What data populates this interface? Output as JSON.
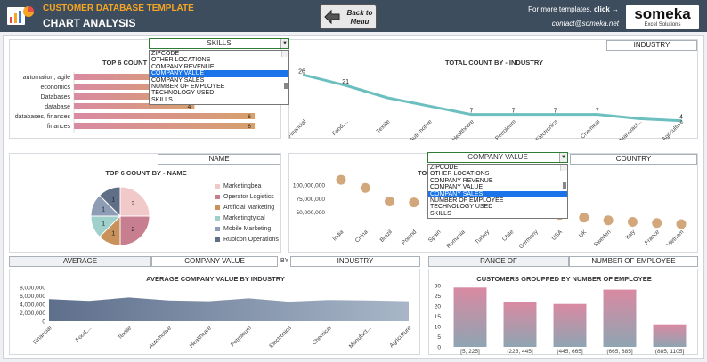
{
  "header": {
    "app_title": "CUSTOMER DATABASE TEMPLATE",
    "page_title": "CHART ANALYSIS",
    "back_button": {
      "line1": "Back to",
      "line2": "Menu"
    },
    "more_templates_prefix": "For more templates, ",
    "more_templates_link": "click →",
    "contact": "contact@someka.net",
    "brand_name": "someka",
    "brand_sub": "Excel Solutions"
  },
  "panel1": {
    "selector_value": "SKILLS",
    "dropdown_options": [
      "ZIPCODE",
      "OTHER LOCATIONS",
      "COMPANY REVENUE",
      "COMPANY VALUE",
      "COMPANY SALES",
      "NUMBER OF EMPLOYEE",
      "TECHNOLOGY USED",
      "SKILLS"
    ],
    "dropdown_selected_index": 3,
    "title_visible": "TOP 6 COUNT"
  },
  "panel2": {
    "selector_value": "INDUSTRY"
  },
  "panel3": {
    "selector_value": "NAME"
  },
  "panel4": {
    "selector_value": "COMPANY VALUE",
    "selector2_value": "COUNTRY",
    "dropdown_options": [
      "ZIPCODE",
      "OTHER LOCATIONS",
      "COMPANY REVENUE",
      "COMPANY VALUE",
      "COMPANY SALES",
      "NUMBER OF EMPLOYEE",
      "TECHNOLOGY USED",
      "SKILLS"
    ],
    "dropdown_selected_index": 4,
    "title_visible": "TO"
  },
  "panel5": {
    "avg_label": "AVERAGE",
    "value_label": "COMPANY VALUE",
    "by_label": "BY",
    "industry_label": "INDUSTRY"
  },
  "panel6": {
    "range_label": "RANGE OF",
    "employee_label": "NUMBER OF EMPLOYEE"
  },
  "colors": {
    "header_bg": "#3e4d5e",
    "accent_orange": "#f5a623",
    "line_teal": "#6bbfbf",
    "dot_tan": "#d2a77c",
    "area_slate": "#5e6f8c",
    "dropdown_highlight": "#1a73e8"
  },
  "chart_data": [
    {
      "type": "bar",
      "orientation": "horizontal",
      "title": "TOP 6 COUNT",
      "categories": [
        "automation, agile",
        "economics",
        "Databases",
        "database",
        "databases, finances",
        "finances"
      ],
      "values": [
        4,
        4,
        4,
        4,
        6,
        6
      ],
      "data_labels_visible": [
        "",
        "",
        "",
        "4",
        "6",
        "6"
      ],
      "xlim": [
        0,
        6.5
      ]
    },
    {
      "type": "line",
      "title": "TOTAL COUNT BY - INDUSTRY",
      "categories": [
        "Financial",
        "Food,...",
        "Textile",
        "Automotive",
        "Healthcare",
        "Petroleum",
        "Electronics",
        "Chemical",
        "Manufact...",
        "Agriculture"
      ],
      "values": [
        26,
        21,
        15,
        11,
        7,
        7,
        7,
        7,
        5,
        4
      ],
      "data_labels_visible": [
        "26",
        "21",
        "",
        "",
        "7",
        "7",
        "7",
        "7",
        "",
        "4"
      ],
      "ylim": [
        0,
        30
      ]
    },
    {
      "type": "pie",
      "title": "TOP 6 COUNT BY - NAME",
      "labels": [
        "Marketingbea",
        "Operator Logistics",
        "Artificial Marketing",
        "Marketingtyical",
        "Mobile Marketing",
        "Rubicon Operations"
      ],
      "values": [
        2,
        2,
        1,
        1,
        1,
        1
      ],
      "colors": [
        "#f2c9c9",
        "#c77e8f",
        "#c9925a",
        "#9fd0cc",
        "#8c9db5",
        "#5f6f88"
      ],
      "legend": "right"
    },
    {
      "type": "scatter",
      "title": "TO",
      "categories": [
        "India",
        "China",
        "Brazil",
        "Poland",
        "Spain",
        "Romania",
        "Turkey",
        "Chile",
        "Germany",
        "USA",
        "UK",
        "Sweden",
        "Italy",
        "France",
        "Vietnam"
      ],
      "values": [
        110000000,
        95000000,
        70000000,
        68000000,
        62000000,
        58000000,
        55000000,
        52000000,
        50000000,
        45000000,
        40000000,
        35000000,
        32000000,
        30000000,
        28000000
      ],
      "yticks": [
        "100,000,000",
        "75,000,000",
        "50,000,000"
      ],
      "ylim": [
        0,
        125000000
      ]
    },
    {
      "type": "area",
      "title": "AVERAGE COMPANY VALUE BY INDUSTRY",
      "categories": [
        "Financial",
        "Food,...",
        "Textile",
        "Automotive",
        "Healthcare",
        "Petroleum",
        "Electronics",
        "Chemical",
        "Manufact...",
        "Agriculture"
      ],
      "values": [
        5200000,
        4800000,
        5600000,
        4900000,
        4700000,
        5400000,
        4600000,
        5000000,
        4900000,
        4700000
      ],
      "yticks": [
        "8,000,000",
        "6,000,000",
        "4,000,000",
        "2,000,000",
        "0"
      ],
      "ylim": [
        0,
        8000000
      ]
    },
    {
      "type": "bar",
      "title": "CUSTOMERS GROUPPED BY NUMBER OF EMPLOYEE",
      "categories": [
        "[5, 225]",
        "(225, 445]",
        "(445, 665]",
        "(665, 885]",
        "(885, 1105]"
      ],
      "values": [
        29,
        22,
        21,
        28,
        11
      ],
      "yticks": [
        "30",
        "25",
        "20",
        "15",
        "10",
        "5",
        "0"
      ],
      "ylim": [
        0,
        30
      ]
    }
  ]
}
